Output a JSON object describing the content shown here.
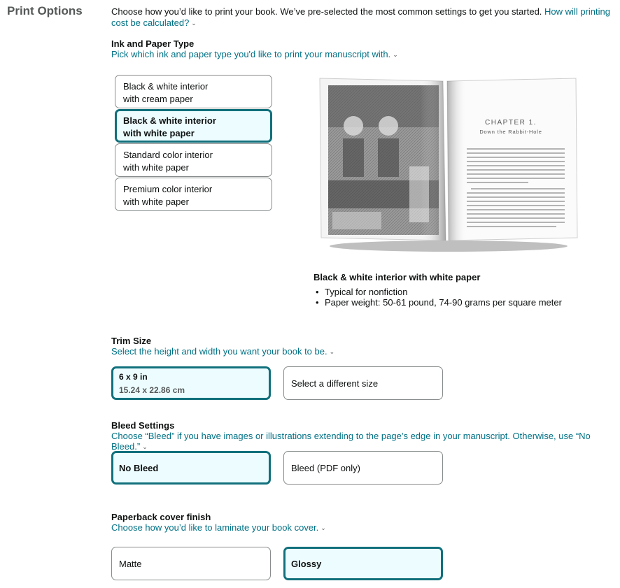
{
  "page_title": "Print Options",
  "intro": {
    "text": "Choose how you’d like to print your book. We’ve pre-selected the most common settings to get you started. ",
    "link": "How will printing cost be calculated?"
  },
  "ink_paper": {
    "heading": "Ink and Paper Type",
    "description": "Pick which ink and paper type you'd like to print your manuscript with.",
    "options": [
      {
        "line1": "Black & white interior",
        "line2": "with cream paper",
        "selected": false
      },
      {
        "line1": "Black & white interior",
        "line2": "with white paper",
        "selected": true
      },
      {
        "line1": "Standard color interior",
        "line2": "with white paper",
        "selected": false
      },
      {
        "line1": "Premium color interior",
        "line2": "with white paper",
        "selected": false
      }
    ],
    "preview": {
      "chapter": "CHAPTER 1.",
      "chapter_subtitle": "Down the Rabbit-Hole",
      "selected_title": "Black & white interior with white paper",
      "bullets": [
        "Typical for nonfiction",
        "Paper weight: 50-61 pound, 74-90 grams per square meter"
      ]
    }
  },
  "trim_size": {
    "heading": "Trim Size",
    "description": "Select the height and width you want your book to be.",
    "selected_size": "6 x 9 in",
    "selected_metric": "15.24 x 22.86 cm",
    "other_option": "Select a different size"
  },
  "bleed": {
    "heading": "Bleed Settings",
    "description": "Choose “Bleed” if you have images or illustrations extending to the page’s edge in your manuscript. Otherwise, use “No Bleed.”",
    "options": [
      "No Bleed",
      "Bleed (PDF only)"
    ],
    "selected_index": 0
  },
  "cover_finish": {
    "heading": "Paperback cover finish",
    "description": "Choose how you’d like to laminate your book cover.",
    "options": [
      "Matte",
      "Glossy"
    ],
    "selected_index": 1
  },
  "colors": {
    "accent": "#11707c",
    "selected_bg": "#edfdff",
    "link": "#007185"
  },
  "icons": {
    "expand": "chevron-down-icon"
  }
}
